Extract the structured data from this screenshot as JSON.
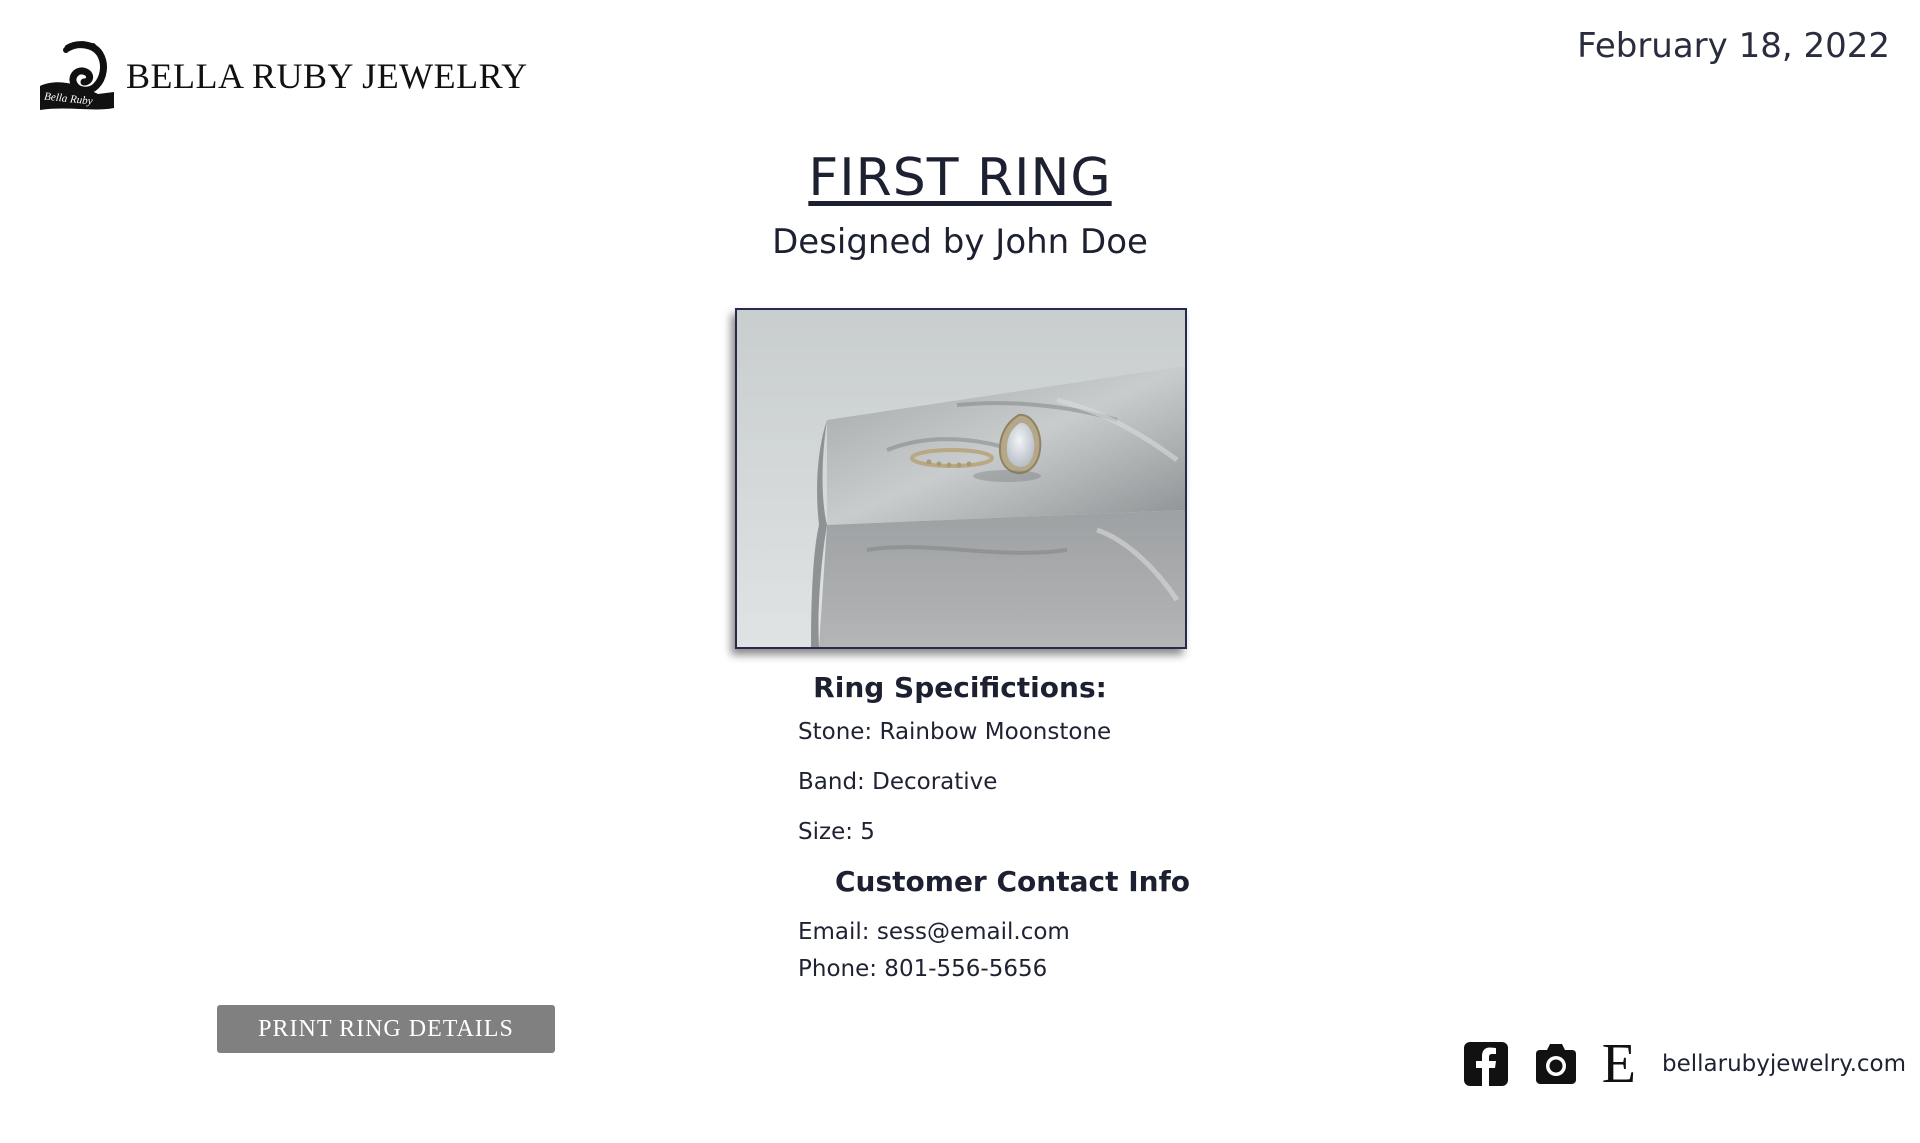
{
  "header": {
    "brand_name": "BELLA RUBY JEWELRY",
    "logo_text": "Bella Ruby",
    "date": "February 18, 2022"
  },
  "ring": {
    "title": "FIRST RING",
    "designer_line": "Designed by John Doe",
    "photo_icon": "ring-photo"
  },
  "specifications": {
    "heading": "Ring Specifictions:",
    "stone": "Stone: Rainbow Moonstone",
    "band": "Band: Decorative",
    "size": "Size: 5"
  },
  "contact": {
    "heading": "Customer Contact Info",
    "email": "Email: sess@email.com",
    "phone": "Phone: 801-556-5656"
  },
  "actions": {
    "print_label": "PRINT RING DETAILS"
  },
  "footer": {
    "icons": [
      "facebook-icon",
      "camera-icon",
      "etsy-icon"
    ],
    "etsy_letter": "E",
    "website": "bellarubyjewelry.com"
  },
  "colors": {
    "text": "#1c2030",
    "button_bg": "#808080",
    "photo_border": "#262b4d"
  }
}
